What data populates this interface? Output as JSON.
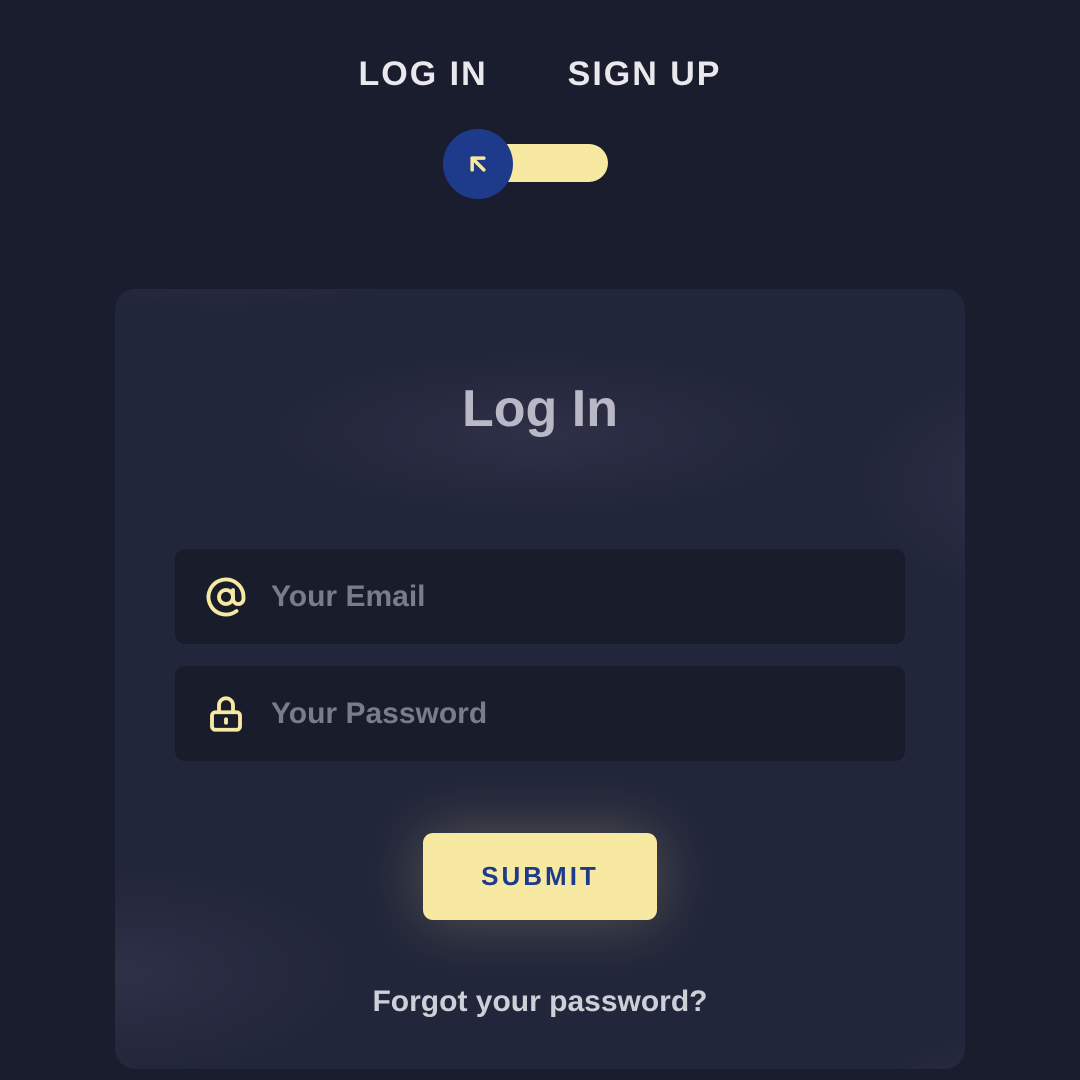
{
  "tabs": {
    "login": "LOG IN",
    "signup": "SIGN UP"
  },
  "toggle": {
    "knob_icon": "arrow-up-left"
  },
  "card": {
    "title": "Log In",
    "email": {
      "placeholder": "Your Email",
      "value": "",
      "icon": "at-sign"
    },
    "password": {
      "placeholder": "Your Password",
      "value": "",
      "icon": "lock"
    },
    "submit_label": "SUBMIT",
    "forgot_label": "Forgot your password?"
  },
  "colors": {
    "bg": "#1a1d2e",
    "card": "#22263a",
    "field": "#191c2b",
    "accent": "#f7e9a1",
    "knob": "#1e3a8a"
  }
}
